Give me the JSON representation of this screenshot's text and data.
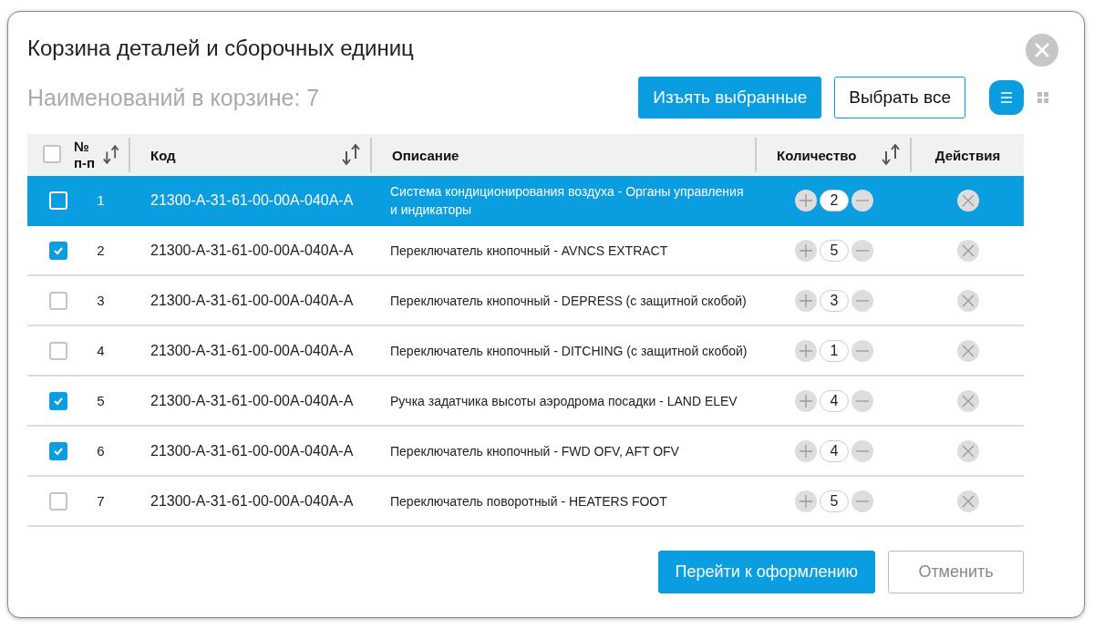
{
  "dialog": {
    "title": "Корзина деталей и сборочных единиц",
    "count_label": "Наименований в корзине: 7"
  },
  "toolbar": {
    "buttons": [
      {
        "label": "Изъять выбранные",
        "kind": "primary"
      },
      {
        "label": "Выбрать все",
        "kind": "outline"
      }
    ],
    "view_modes": [
      {
        "kind": "list",
        "selected": true
      },
      {
        "kind": "grid",
        "selected": false
      }
    ]
  },
  "table": {
    "select_all_checked": false,
    "columns": [
      {
        "label": "№ п-п",
        "sortable": true
      },
      {
        "label": "Код",
        "sortable": true
      },
      {
        "label": "Описание",
        "sortable": false
      },
      {
        "label": "Количество",
        "sortable": true
      },
      {
        "label": "Действия",
        "sortable": false
      }
    ],
    "rows": [
      {
        "checked": false,
        "selected": true,
        "number": "1",
        "code": "21300-A-31-61-00-00A-040A-A",
        "description": "Система кондиционирования воздуха - Органы управления и индикаторы",
        "quantity": "2"
      },
      {
        "checked": true,
        "selected": false,
        "number": "2",
        "code": "21300-A-31-61-00-00A-040A-A",
        "description": "Переключатель кнопочный - AVNCS EXTRACT",
        "quantity": "5"
      },
      {
        "checked": false,
        "selected": false,
        "number": "3",
        "code": "21300-A-31-61-00-00A-040A-A",
        "description": "Переключатель кнопочный - DEPRESS (с защитной скобой)",
        "quantity": "3"
      },
      {
        "checked": false,
        "selected": false,
        "number": "4",
        "code": "21300-A-31-61-00-00A-040A-A",
        "description": "Переключатель кнопочный - DITCHING (с защитной скобой)",
        "quantity": "1"
      },
      {
        "checked": true,
        "selected": false,
        "number": "5",
        "code": "21300-A-31-61-00-00A-040A-A",
        "description": "Ручка задатчика высоты аэродрома посадки - LAND ELEV",
        "quantity": "4"
      },
      {
        "checked": true,
        "selected": false,
        "number": "6",
        "code": "21300-A-31-61-00-00A-040A-A",
        "description": "Переключатель кнопочный - FWD OFV, AFT OFV",
        "quantity": "4"
      },
      {
        "checked": false,
        "selected": false,
        "number": "7",
        "code": "21300-A-31-61-00-00A-040A-A",
        "description": "Переключатель поворотный - HEATERS FOOT",
        "quantity": "5"
      }
    ]
  },
  "footer": {
    "buttons": [
      {
        "label": "Перейти к оформлению",
        "kind": "primary"
      },
      {
        "label": "Отменить",
        "kind": "secondary"
      }
    ]
  }
}
